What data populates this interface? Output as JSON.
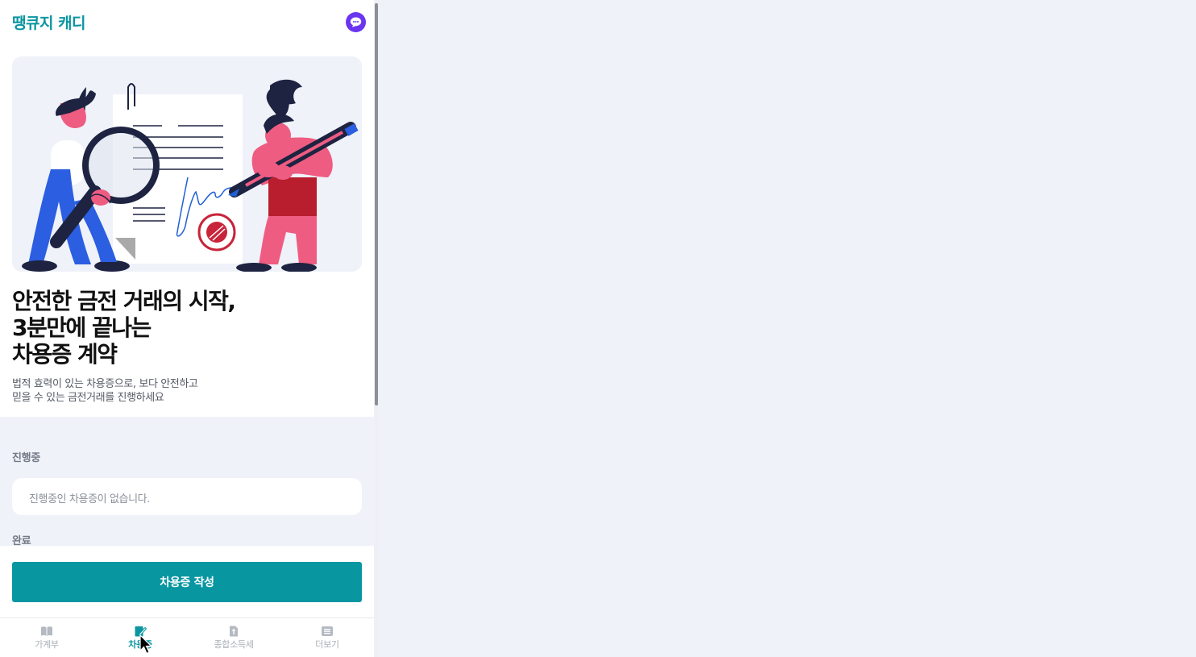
{
  "app": {
    "logo_text": "땡큐지 캐디"
  },
  "colors": {
    "brand": "#0a95a1",
    "chat": "#6b35f0",
    "cta": "#0896a1"
  },
  "hero": {
    "headline_lines": [
      "안전한 금전 거래의 시작,",
      "3분만에 끝나는",
      "차용증 계약"
    ],
    "subtext_lines": [
      "법적 효력이 있는 차용증으로, 보다 안전하고",
      "믿을 수 있는 금전거래를 진행하세요"
    ]
  },
  "sections": {
    "in_progress": {
      "label": "진행중",
      "empty_text": "진행중인 차용증이 없습니다."
    },
    "completed": {
      "label": "완료"
    }
  },
  "cta": {
    "label": "차용증 작성"
  },
  "nav": {
    "items": [
      {
        "label": "가계부",
        "icon": "book-icon",
        "active": false
      },
      {
        "label": "차용증",
        "icon": "document-pen-icon",
        "active": true
      },
      {
        "label": "종합소득세",
        "icon": "tax-document-icon",
        "active": false
      },
      {
        "label": "더보기",
        "icon": "list-icon",
        "active": false
      }
    ]
  }
}
